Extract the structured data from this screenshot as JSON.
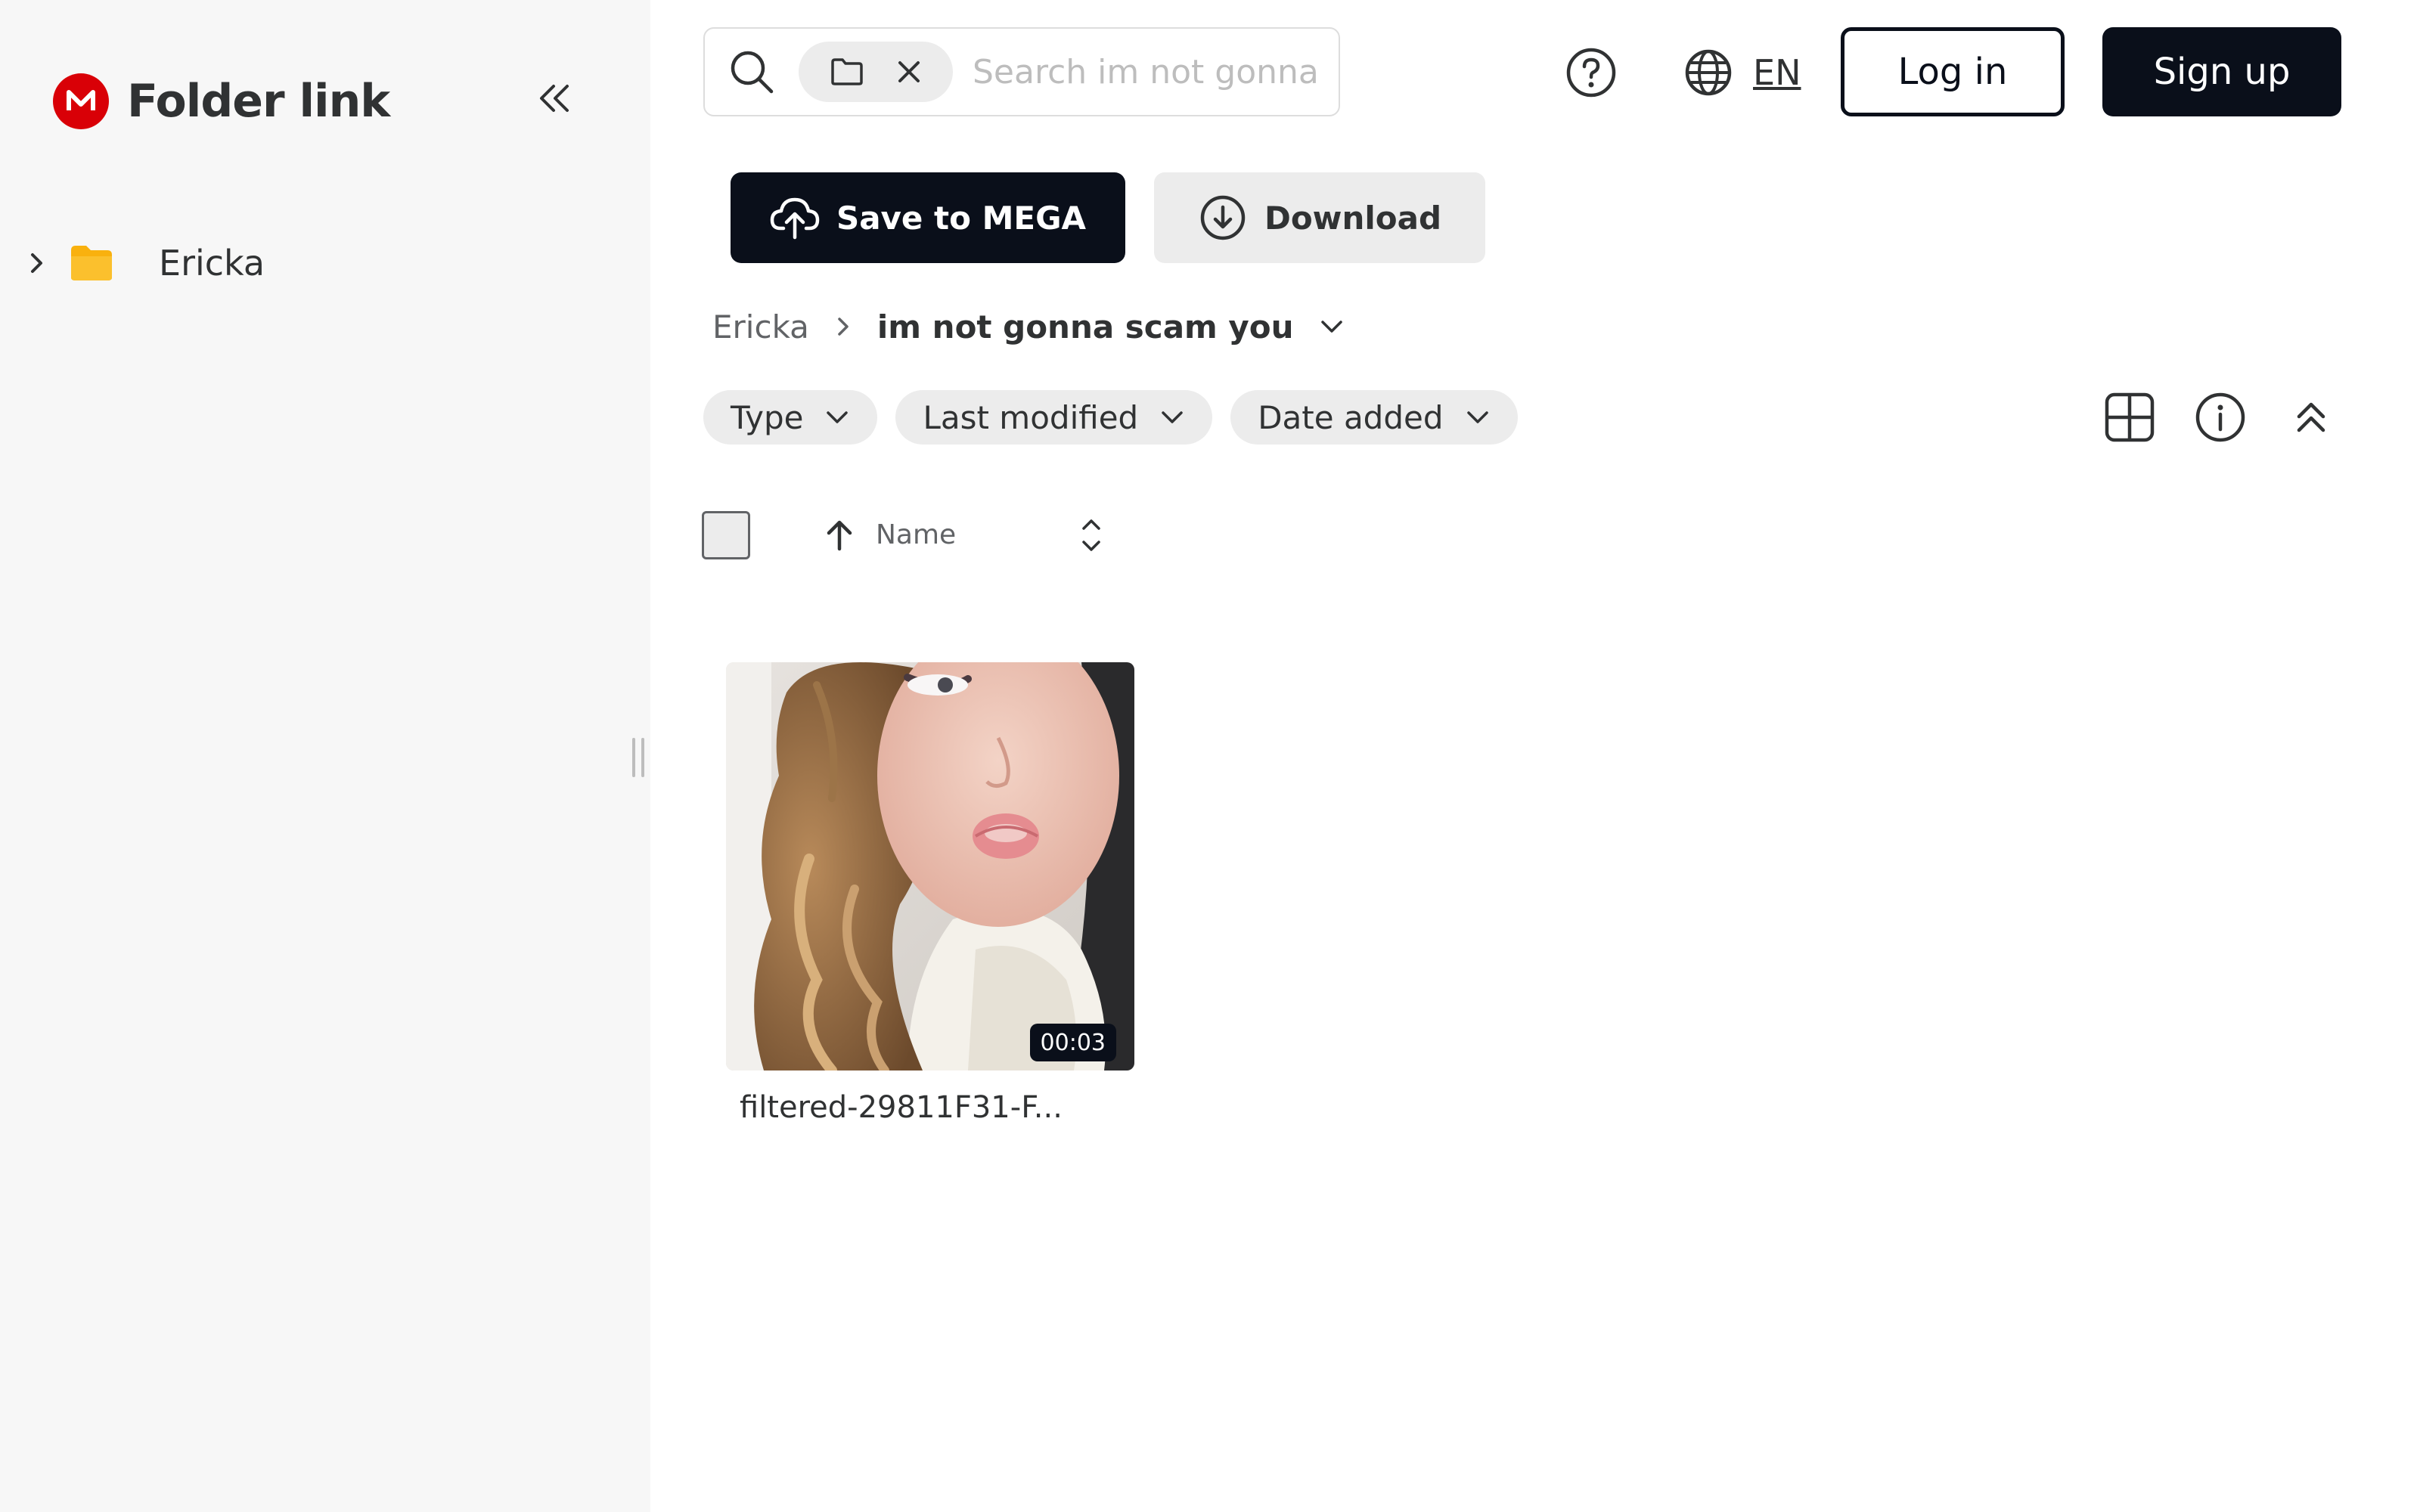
{
  "brand": {
    "title": "Folder link",
    "logo_letter": "M",
    "color": "#d90007"
  },
  "sidebar": {
    "tree": [
      {
        "label": "Ericka",
        "icon": "folder-icon",
        "expanded": false
      }
    ]
  },
  "search": {
    "placeholder": "Search im not gonna ...",
    "value": ""
  },
  "header": {
    "language": "EN",
    "login_label": "Log in",
    "signup_label": "Sign up"
  },
  "actions": {
    "save_label": "Save to MEGA",
    "download_label": "Download"
  },
  "breadcrumb": {
    "root": "Ericka",
    "current": "im not gonna scam you"
  },
  "filters": [
    {
      "label": "Type"
    },
    {
      "label": "Last modified"
    },
    {
      "label": "Date added"
    }
  ],
  "table": {
    "column_name": "Name",
    "sort": "ascending"
  },
  "items": [
    {
      "name": "filtered-29811F31-F...",
      "type": "video",
      "duration": "00:03"
    }
  ],
  "colors": {
    "primary": "#0a0f1a",
    "sidebar_bg": "#f7f7f7",
    "chip_bg": "#ececec",
    "folder": "#f9b10e"
  }
}
